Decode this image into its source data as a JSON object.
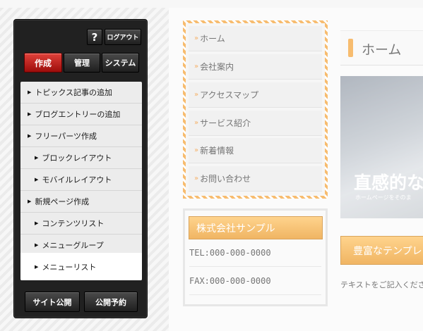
{
  "panel": {
    "help_label": "?",
    "logout_label": "ログアウト",
    "tabs": [
      {
        "label": "作成",
        "active": true
      },
      {
        "label": "管理",
        "active": false
      },
      {
        "label": "システム",
        "active": false
      }
    ],
    "menu_items": [
      {
        "label": "トピックス記事の追加",
        "indent": 0
      },
      {
        "label": "ブログエントリーの追加",
        "indent": 0
      },
      {
        "label": "フリーパーツ作成",
        "indent": 0
      },
      {
        "label": "ブロックレイアウト",
        "indent": 1
      },
      {
        "label": "モバイルレイアウト",
        "indent": 1
      },
      {
        "label": "新規ページ作成",
        "indent": 0
      },
      {
        "label": "コンテンツリスト",
        "indent": 1
      },
      {
        "label": "メニューグループ",
        "indent": 1
      },
      {
        "label": "メニューリスト",
        "indent": 1,
        "active": true
      }
    ],
    "publish_label": "サイト公開",
    "schedule_label": "公開予約"
  },
  "site": {
    "nav": [
      {
        "label": "ホーム"
      },
      {
        "label": "会社案内"
      },
      {
        "label": "アクセスマップ"
      },
      {
        "label": "サービス紹介"
      },
      {
        "label": "新着情報"
      },
      {
        "label": "お問い合わせ"
      }
    ],
    "nav_chevron": "»",
    "company_name": "株式会社サンプル",
    "tel": "TEL:000-000-0000",
    "fax": "FAX:000-000-0000",
    "page_title": "ホーム",
    "hero_text": "直感的な",
    "hero_sub": "ホームページをそのま",
    "feature_button": "豊富なテンプレー",
    "body_text": "テキストをご記入くださ"
  },
  "colors": {
    "accent_orange": "#f39d2b",
    "tab_active_red": "#c0201c",
    "panel_bg": "#212121"
  }
}
